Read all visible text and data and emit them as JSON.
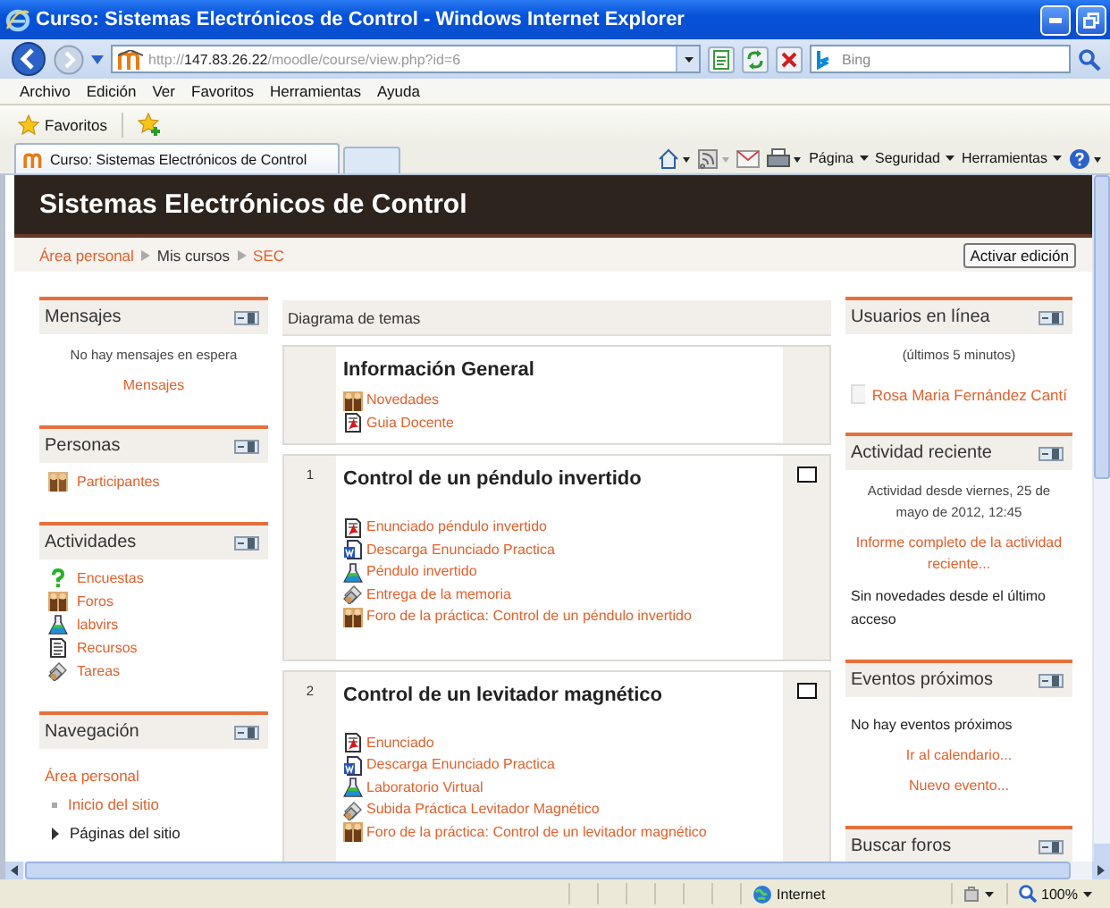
{
  "window": {
    "title": "Curso: Sistemas Electrónicos de Control - Windows Internet Explorer"
  },
  "address": {
    "url": "http://**147.83.26.22**/moodle/course/view.php?id=6"
  },
  "search": {
    "placeholder": "Bing"
  },
  "menu": [
    {
      "label": "Archivo"
    },
    {
      "label": "Edición"
    },
    {
      "label": "Ver"
    },
    {
      "label": "Favoritos"
    },
    {
      "label": "Herramientas"
    },
    {
      "label": "Ayuda"
    }
  ],
  "favorites": {
    "label": "Favoritos"
  },
  "tabs": [
    {
      "label": "Curso: Sistemas Electrónicos de Control",
      "selected": true
    }
  ],
  "command_bar": [
    {
      "label": "Página"
    },
    {
      "label": "Seguridad"
    },
    {
      "label": "Herramientas"
    }
  ],
  "page": {
    "title": "Sistemas Electrónicos de Control",
    "breadcrumb": [
      {
        "label": "Área personal",
        "kind": "link"
      },
      {
        "label": "Mis cursos",
        "kind": "text"
      },
      {
        "label": "SEC",
        "kind": "link"
      }
    ],
    "edit_button": "Activar edición"
  },
  "left_blocks": [
    {
      "title": "Mensajes",
      "items": [
        {
          "kind": "note",
          "text": "No hay mensajes en espera"
        },
        {
          "kind": "center_link",
          "text": "Mensajes"
        }
      ]
    },
    {
      "title": "Personas",
      "items": [
        {
          "kind": "people",
          "text": "Participantes"
        }
      ]
    },
    {
      "title": "Actividades",
      "items": [
        {
          "kind": "survey",
          "text": "Encuestas"
        },
        {
          "kind": "forum",
          "text": "Foros"
        },
        {
          "kind": "lab",
          "text": "labvirs"
        },
        {
          "kind": "resource",
          "text": "Recursos"
        },
        {
          "kind": "assignment",
          "text": "Tareas"
        }
      ]
    },
    {
      "title": "Navegación",
      "items": [
        {
          "kind": "link",
          "text": "Área personal"
        },
        {
          "kind": "bullet_link",
          "text": "Inicio del sitio"
        },
        {
          "kind": "branch",
          "text": "Páginas del sitio"
        }
      ]
    }
  ],
  "course": {
    "heading": "Diagrama de temas",
    "sections": [
      {
        "title": "Información General",
        "marker": false,
        "items": [
          {
            "kind": "forum",
            "label": "Novedades"
          },
          {
            "kind": "pdf",
            "label": "Guia Docente"
          }
        ]
      },
      {
        "number": "1",
        "title": "Control de un péndulo invertido",
        "marker": true,
        "items": [
          {
            "kind": "pdf",
            "label": "Enunciado péndulo invertido"
          },
          {
            "kind": "word",
            "label": "Descarga Enunciado Practica"
          },
          {
            "kind": "lab",
            "label": "Péndulo invertido"
          },
          {
            "kind": "assignment",
            "label": "Entrega de la memoria"
          },
          {
            "kind": "forum",
            "label": "Foro de la práctica: Control de un péndulo invertido"
          }
        ]
      },
      {
        "number": "2",
        "title": "Control de un levitador magnético",
        "marker": true,
        "items": [
          {
            "kind": "pdf",
            "label": "Enunciado"
          },
          {
            "kind": "word",
            "label": "Descarga Enunciado Practica"
          },
          {
            "kind": "lab",
            "label": "Laboratorio Virtual"
          },
          {
            "kind": "assignment",
            "label": "Subida Práctica Levitador Magnético"
          },
          {
            "kind": "forum",
            "label": "Foro de la práctica: Control de un levitador magnético"
          }
        ]
      }
    ]
  },
  "right_blocks": [
    {
      "title": "Usuarios en línea",
      "items": [
        {
          "kind": "note",
          "text": "(últimos 5 minutos)"
        },
        {
          "kind": "user",
          "text": "Rosa Maria Fernández Cantí"
        }
      ]
    },
    {
      "title": "Actividad reciente",
      "items": [
        {
          "kind": "note",
          "text": "Actividad desde viernes, 25 de mayo de 2012, 12:45"
        },
        {
          "kind": "center_link",
          "text": "Informe completo de la actividad reciente..."
        },
        {
          "kind": "text",
          "text": "Sin novedades desde el último acceso"
        }
      ]
    },
    {
      "title": "Eventos próximos",
      "items": [
        {
          "kind": "text",
          "text": "No hay eventos próximos"
        },
        {
          "kind": "center_link",
          "text": "Ir al calendario..."
        },
        {
          "kind": "center_link",
          "text": "Nuevo evento..."
        }
      ]
    },
    {
      "title": "Buscar foros"
    }
  ],
  "status_bar": {
    "zone": "Internet",
    "zoom": "100%"
  }
}
